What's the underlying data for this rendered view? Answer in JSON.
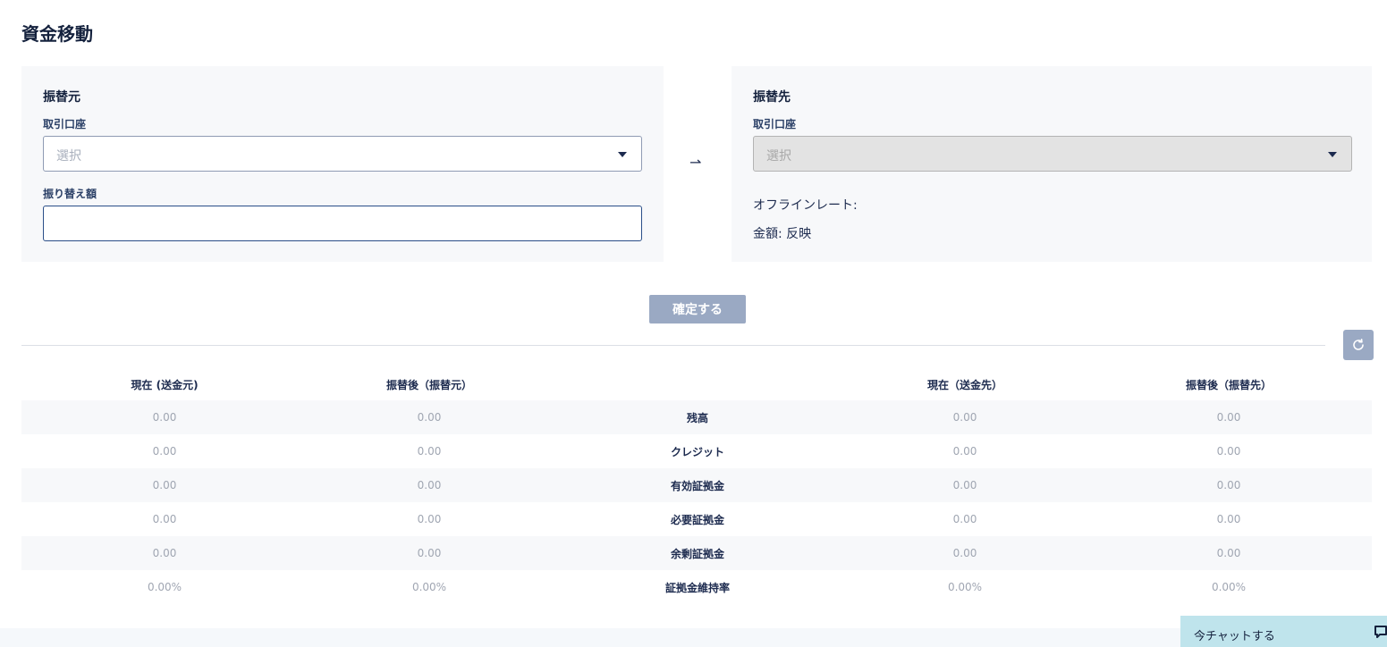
{
  "page": {
    "title": "資金移動"
  },
  "from_panel": {
    "heading": "振替元",
    "account_label": "取引口座",
    "account_placeholder": "選択",
    "amount_label": "振り替え額",
    "amount_value": ""
  },
  "arrow": "⇀",
  "to_panel": {
    "heading": "振替先",
    "account_label": "取引口座",
    "account_placeholder": "選択",
    "offline_rate": "オフラインレート:",
    "amount_reflect": "金額: 反映"
  },
  "confirm_label": "確定する",
  "table": {
    "headers": [
      "現在 (送金元)",
      "振替後（振替元）",
      "",
      "現在（送金先）",
      "振替後（振替先）"
    ],
    "rows": [
      {
        "label": "残高",
        "from_now": "0.00",
        "from_after": "0.00",
        "to_now": "0.00",
        "to_after": "0.00"
      },
      {
        "label": "クレジット",
        "from_now": "0.00",
        "from_after": "0.00",
        "to_now": "0.00",
        "to_after": "0.00"
      },
      {
        "label": "有効証拠金",
        "from_now": "0.00",
        "from_after": "0.00",
        "to_now": "0.00",
        "to_after": "0.00"
      },
      {
        "label": "必要証拠金",
        "from_now": "0.00",
        "from_after": "0.00",
        "to_now": "0.00",
        "to_after": "0.00"
      },
      {
        "label": "余剰証拠金",
        "from_now": "0.00",
        "from_after": "0.00",
        "to_now": "0.00",
        "to_after": "0.00"
      },
      {
        "label": "証拠金維持率",
        "from_now": "0.00%",
        "from_after": "0.00%",
        "to_now": "0.00%",
        "to_after": "0.00%"
      }
    ]
  },
  "chat": {
    "label": "今チャットする",
    "icon": "chat-bubble-icon"
  },
  "icons": {
    "refresh": "refresh-icon",
    "dropdown": "chevron-down-icon"
  },
  "colors": {
    "primary": "#1d2b4f",
    "button_disabled": "#9aa9c3",
    "panel_bg": "#f7f8fa",
    "chat_bg": "#bfe4ec"
  }
}
